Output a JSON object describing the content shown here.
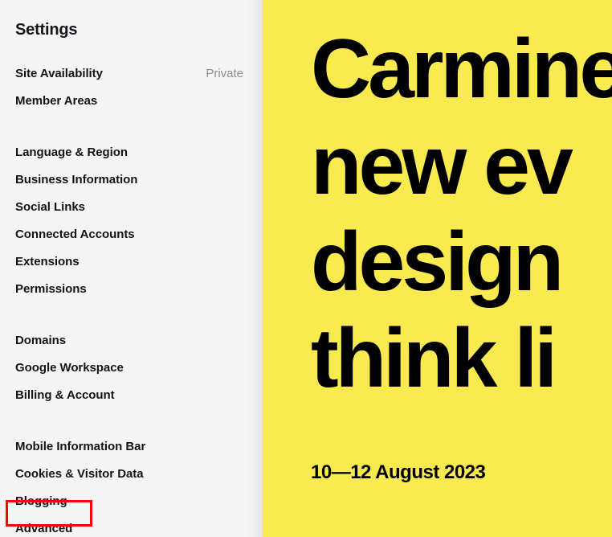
{
  "sidebar": {
    "title": "Settings",
    "groups": [
      {
        "items": [
          {
            "label": "Site Availability",
            "value": "Private"
          },
          {
            "label": "Member Areas",
            "value": ""
          }
        ]
      },
      {
        "items": [
          {
            "label": "Language & Region",
            "value": ""
          },
          {
            "label": "Business Information",
            "value": ""
          },
          {
            "label": "Social Links",
            "value": ""
          },
          {
            "label": "Connected Accounts",
            "value": ""
          },
          {
            "label": "Extensions",
            "value": ""
          },
          {
            "label": "Permissions",
            "value": ""
          }
        ]
      },
      {
        "items": [
          {
            "label": "Domains",
            "value": ""
          },
          {
            "label": "Google Workspace",
            "value": ""
          },
          {
            "label": "Billing & Account",
            "value": ""
          }
        ]
      },
      {
        "items": [
          {
            "label": "Mobile Information Bar",
            "value": ""
          },
          {
            "label": "Cookies & Visitor Data",
            "value": ""
          },
          {
            "label": "Blogging",
            "value": ""
          },
          {
            "label": "Advanced",
            "value": ""
          }
        ]
      }
    ],
    "background_color": "#f5f5f5",
    "text_color": "#111418",
    "value_color": "#8a8f94"
  },
  "annotation": {
    "target_label": "Advanced",
    "color": "#ff0000"
  },
  "preview": {
    "background_color": "#f9ea50",
    "text_color": "#000000",
    "headline_lines": [
      "Carmine:",
      "new ev",
      "design",
      "think li"
    ],
    "event_date": "10—12 August 2023"
  }
}
